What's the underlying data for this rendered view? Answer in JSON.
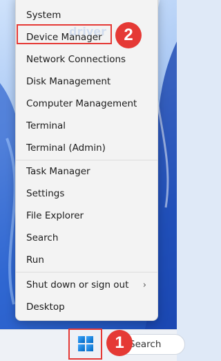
{
  "menu": {
    "items": [
      {
        "label": "System"
      },
      {
        "label": "Device Manager"
      },
      {
        "label": "Network Connections"
      },
      {
        "label": "Disk Management"
      },
      {
        "label": "Computer Management"
      },
      {
        "label": "Terminal"
      },
      {
        "label": "Terminal (Admin)"
      },
      {
        "label": "Task Manager"
      },
      {
        "label": "Settings"
      },
      {
        "label": "File Explorer"
      },
      {
        "label": "Search"
      },
      {
        "label": "Run"
      },
      {
        "label": "Shut down or sign out"
      },
      {
        "label": "Desktop"
      }
    ]
  },
  "annotations": {
    "step1": "1",
    "step2": "2",
    "highlight_color": "#e53935"
  },
  "taskbar": {
    "search_label": "Search"
  },
  "icons": {
    "submenu": "chevron-right-icon",
    "start": "windows-logo-icon"
  }
}
